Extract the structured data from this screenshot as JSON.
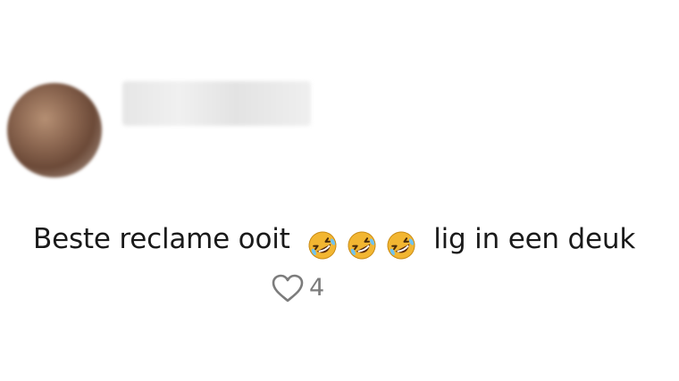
{
  "comment": {
    "avatar": {
      "blurred": true
    },
    "username": {
      "blurred": true
    },
    "text_before": "Beste reclame ooit",
    "emoji": {
      "name": "rolling-on-the-floor-laughing",
      "count": 3
    },
    "text_after": "lig in een deuk",
    "likes": {
      "icon": "heart-outline-icon",
      "count": "4"
    }
  },
  "colors": {
    "background": "#ffffff",
    "text": "#1a1a1a",
    "muted": "#7c7c7c",
    "emoji_face": "#f2b632"
  }
}
